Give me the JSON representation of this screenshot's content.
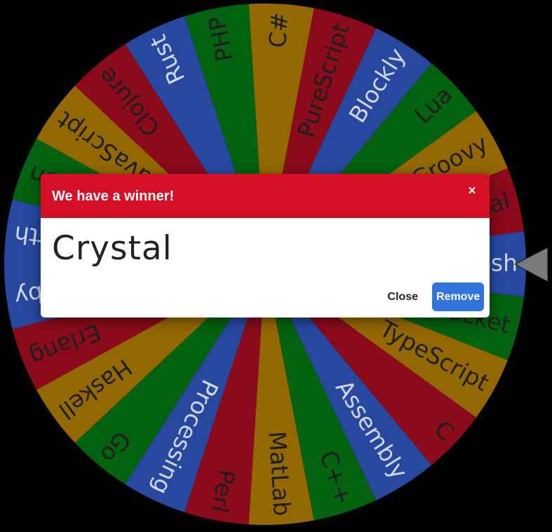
{
  "wheel": {
    "segments": [
      {
        "label": "Crystal",
        "color": "#8b0a1c"
      },
      {
        "label": "Groovy",
        "color": "#946800"
      },
      {
        "label": "Lua",
        "color": "#03620f"
      },
      {
        "label": "Blockly",
        "color": "#2848a0"
      },
      {
        "label": "PureScript",
        "color": "#8b0a1c"
      },
      {
        "label": "C#",
        "color": "#946800"
      },
      {
        "label": "PHP",
        "color": "#03620f"
      },
      {
        "label": "Rust",
        "color": "#2848a0"
      },
      {
        "label": "Clojure",
        "color": "#8b0a1c"
      },
      {
        "label": "JavaScript",
        "color": "#946800"
      },
      {
        "label": "Python",
        "color": "#03620f"
      },
      {
        "label": "Forth",
        "color": "#2848a0"
      },
      {
        "label": "Ruby",
        "color": "#2848a0"
      },
      {
        "label": "Erlang",
        "color": "#8b0a1c"
      },
      {
        "label": "Haskell",
        "color": "#946800"
      },
      {
        "label": "Go",
        "color": "#03620f"
      },
      {
        "label": "Processing",
        "color": "#2848a0"
      },
      {
        "label": "Perl",
        "color": "#8b0a1c"
      },
      {
        "label": "MatLab",
        "color": "#946800"
      },
      {
        "label": "C++",
        "color": "#03620f"
      },
      {
        "label": "Assembly",
        "color": "#2848a0"
      },
      {
        "label": "C",
        "color": "#8b0a1c"
      },
      {
        "label": "TypeScript",
        "color": "#946800"
      },
      {
        "label": "Racket",
        "color": "#03620f"
      },
      {
        "label": "Bash",
        "color": "#2848a0"
      }
    ],
    "pointer_color": "#7a7a7a"
  },
  "modal": {
    "title": "We have a winner!",
    "close_icon": "×",
    "winner": "Crystal",
    "close_label": "Close",
    "remove_label": "Remove",
    "header_color": "#d50f25",
    "remove_color": "#3273dc"
  }
}
